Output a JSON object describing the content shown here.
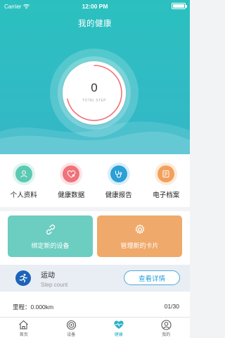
{
  "status_bar": {
    "carrier": "Carrier",
    "time": "12:00 PM"
  },
  "header": {
    "title": "我的健康"
  },
  "steps": {
    "value": "0",
    "label": "TOTAL STEP"
  },
  "quick_actions": [
    {
      "label": "个人资料",
      "icon": "person-icon",
      "color": "#5cc9b3"
    },
    {
      "label": "健康数据",
      "icon": "heart-icon",
      "color": "#f0727a"
    },
    {
      "label": "健康报告",
      "icon": "stethoscope-icon",
      "color": "#2c9fd6"
    },
    {
      "label": "电子档案",
      "icon": "document-icon",
      "color": "#f2a05c"
    }
  ],
  "cards": {
    "bind_device": "绑定新的设备",
    "manage_card": "管理新的卡片"
  },
  "sport": {
    "title": "运动",
    "subtitle": "Step count",
    "detail_button": "查看详情"
  },
  "distance": {
    "label": "里程：0.000km",
    "page": "01/30"
  },
  "tabs": [
    {
      "label": "首页",
      "icon": "home-icon"
    },
    {
      "label": "设备",
      "icon": "device-icon"
    },
    {
      "label": "健康",
      "icon": "heartbeat-icon"
    },
    {
      "label": "我的",
      "icon": "user-icon"
    }
  ],
  "colors": {
    "primary": "#2bc0bf",
    "accent_blue": "#2aa0d9",
    "card_teal": "#6ccdc1",
    "card_orange": "#efa96a",
    "progress_red": "#f0727a"
  }
}
